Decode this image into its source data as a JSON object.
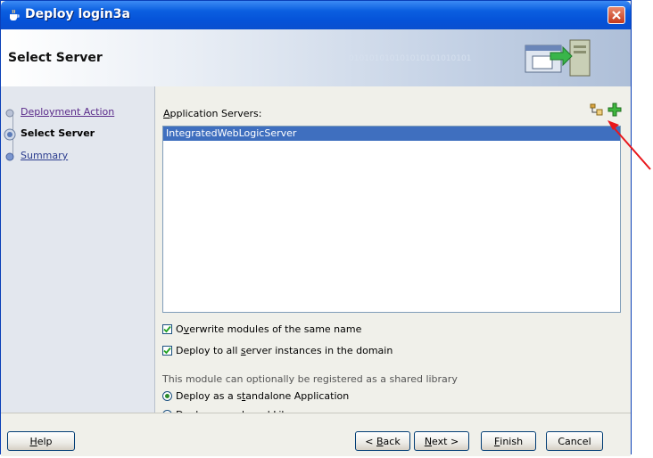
{
  "window": {
    "title": "Deploy login3a"
  },
  "header": {
    "title": "Select Server",
    "binary_text": "010101010101010101010101"
  },
  "nav": {
    "items": [
      {
        "label": "Deployment Action"
      },
      {
        "label": "Select Server"
      },
      {
        "label": "Summary"
      }
    ]
  },
  "main": {
    "servers_label_mnemonic": "A",
    "servers_label_rest": "pplication Servers:",
    "servers": [
      "IntegratedWebLogicServer"
    ],
    "overwrite_pre": "O",
    "overwrite_mn": "v",
    "overwrite_rest": "erwrite modules of the same name",
    "overwrite_checked": true,
    "deploy_all_pre": "Deploy to all ",
    "deploy_all_mn": "s",
    "deploy_all_rest": "erver instances in the domain",
    "deploy_all_checked": true,
    "info_text": "This module can optionally be registered as a shared library",
    "radio_standalone_pre": "Deploy as a s",
    "radio_standalone_mn": "t",
    "radio_standalone_rest": "andalone Application",
    "radio_shared_pre": "Dep",
    "radio_shared_mn": "l",
    "radio_shared_rest": "oy as a shared Library",
    "selected_option": "standalone"
  },
  "buttons": {
    "help_mn": "H",
    "help_rest": "elp",
    "back_pre": "< ",
    "back_mn": "B",
    "back_rest": "ack",
    "next_mn": "N",
    "next_rest": "ext >",
    "finish_mn": "F",
    "finish_rest": "inish",
    "cancel": "Cancel"
  },
  "colors": {
    "accent": "#0552d8",
    "selection": "#3f6fbf",
    "annotation_arrow": "#e8161b"
  }
}
